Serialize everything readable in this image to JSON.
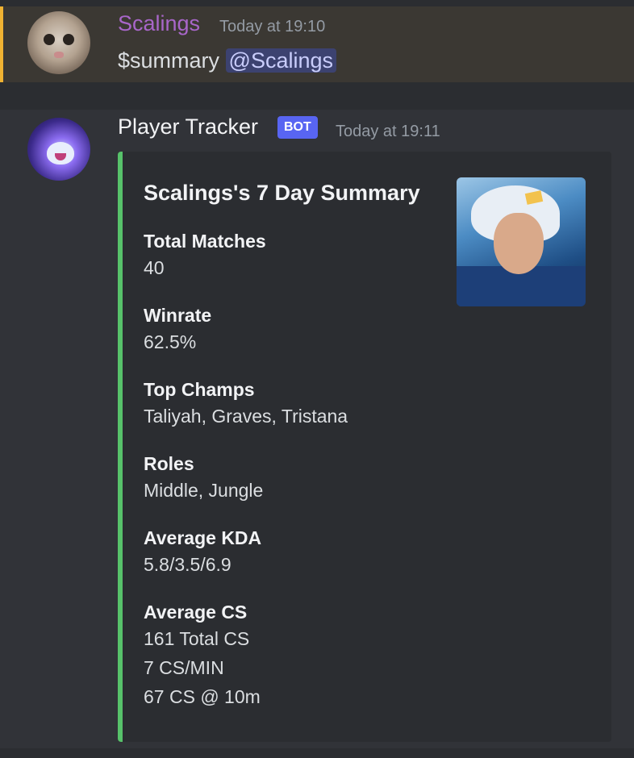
{
  "message1": {
    "author": "Scalings",
    "timestamp": "Today at 19:10",
    "command": "$summary",
    "mention": "@Scalings"
  },
  "message2": {
    "author": "Player Tracker",
    "badge": "BOT",
    "timestamp": "Today at 19:11",
    "embed": {
      "title": "Scalings's 7 Day Summary",
      "accent_color": "#57c26a",
      "fields": [
        {
          "name": "Total Matches",
          "value": "40"
        },
        {
          "name": "Winrate",
          "value": "62.5%"
        },
        {
          "name": "Top Champs",
          "value": "Taliyah, Graves, Tristana"
        },
        {
          "name": "Roles",
          "value": "Middle, Jungle"
        },
        {
          "name": "Average KDA",
          "value": "5.8/3.5/6.9"
        },
        {
          "name": "Average CS",
          "lines": [
            "161 Total CS",
            "7 CS/MIN",
            "67 CS @ 10m"
          ]
        }
      ]
    }
  },
  "colors": {
    "background": "#2b2d31",
    "mention_highlight_bar": "#f0b232",
    "username_scalings": "#a866c9",
    "bot_badge": "#5865f2"
  }
}
